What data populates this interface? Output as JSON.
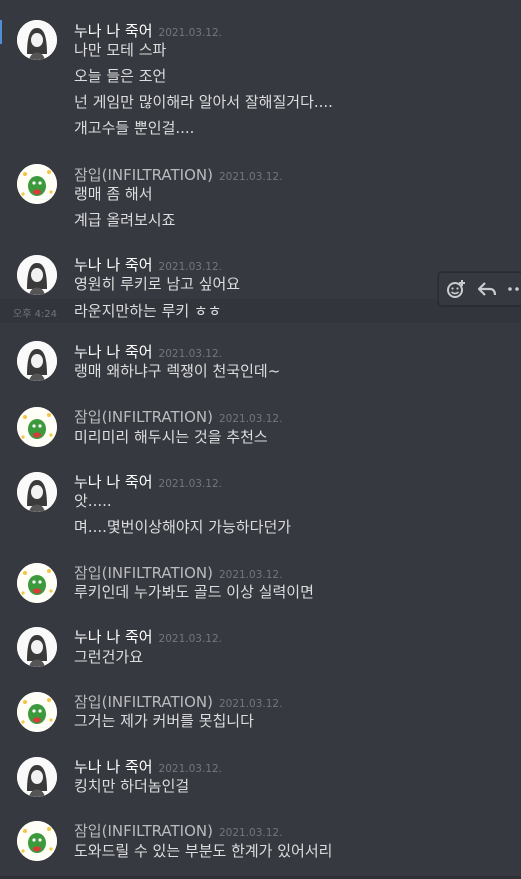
{
  "users": {
    "noona": "누나 나 죽어",
    "jamip": "잠입(INFILTRATION)"
  },
  "timestamp": "2021.03.12.",
  "hover_time": "오후 4:24",
  "messages": [
    {
      "user": "누나 나 죽어",
      "ts": "2021.03.12.",
      "lines": [
        "나만 모테 스파",
        "오늘 들은 조언",
        "넌 게임만 많이해라 알아서 잘해질거다....",
        "개고수들 뿐인걸...."
      ]
    },
    {
      "user": "잠입(INFILTRATION)",
      "ts": "2021.03.12.",
      "lines": [
        "랭매 좀 해서",
        "계급 올려보시죠"
      ]
    },
    {
      "user": "누나 나 죽어",
      "ts": "2021.03.12.",
      "lines": [
        "영원히 루키로 남고 싶어요",
        "라운지만하는 루키 ㅎㅎ"
      ]
    },
    {
      "user": "누나 나 죽어",
      "ts": "2021.03.12.",
      "lines": [
        "랭매 왜하냐구 렉쟁이 천국인데~"
      ]
    },
    {
      "user": "잠입(INFILTRATION)",
      "ts": "2021.03.12.",
      "lines": [
        "미리미리 해두시는 것을 추천스"
      ]
    },
    {
      "user": "누나 나 죽어",
      "ts": "2021.03.12.",
      "lines": [
        "앗.....",
        "며....몇번이상해야지 가능하다던가"
      ]
    },
    {
      "user": "잠입(INFILTRATION)",
      "ts": "2021.03.12.",
      "lines": [
        "루키인데 누가봐도 골드 이상 실력이면"
      ]
    },
    {
      "user": "누나 나 죽어",
      "ts": "2021.03.12.",
      "lines": [
        "그런건가요"
      ]
    },
    {
      "user": "잠입(INFILTRATION)",
      "ts": "2021.03.12.",
      "lines": [
        "그거는 제가 커버를 못칩니다"
      ]
    },
    {
      "user": "누나 나 죽어",
      "ts": "2021.03.12.",
      "lines": [
        "킹치만 하더놈인걸"
      ]
    },
    {
      "user": "잠입(INFILTRATION)",
      "ts": "2021.03.12.",
      "lines": [
        "도와드릴 수 있는 부분도 한계가 있어서리"
      ]
    }
  ],
  "toolbar": {
    "icons": [
      "add-reaction-icon",
      "reply-icon",
      "more-icon"
    ]
  }
}
